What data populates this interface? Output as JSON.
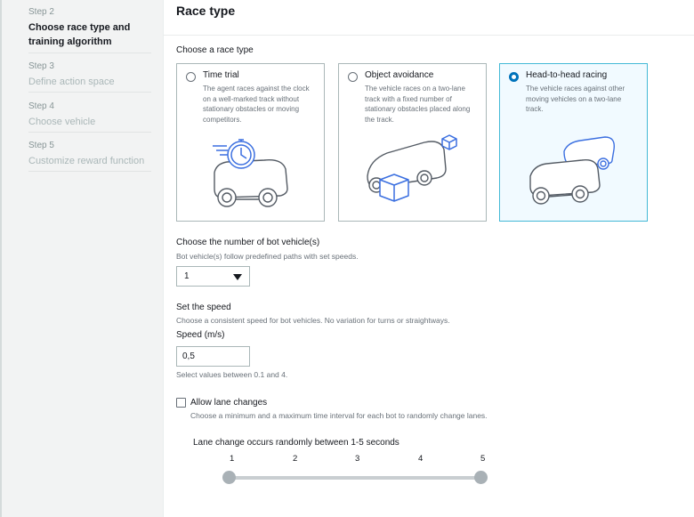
{
  "sidebar": {
    "steps": [
      {
        "number": "Step 2",
        "title": "Choose race type and training algorithm",
        "active": true
      },
      {
        "number": "Step 3",
        "title": "Define action space",
        "active": false
      },
      {
        "number": "Step 4",
        "title": "Choose vehicle",
        "active": false
      },
      {
        "number": "Step 5",
        "title": "Customize reward function",
        "active": false
      }
    ]
  },
  "header": {
    "title": "Race type"
  },
  "race_type": {
    "label": "Choose a race type",
    "selected": "Head-to-head racing",
    "options": [
      {
        "title": "Time trial",
        "description": "The agent races against the clock on a well-marked track without stationary obstacles or moving competitors.",
        "icon": "stopwatch-car-icon"
      },
      {
        "title": "Object avoidance",
        "description": "The vehicle races on a two-lane track with a fixed number of stationary obstacles placed along the track.",
        "icon": "car-obstacles-icon"
      },
      {
        "title": "Head-to-head racing",
        "description": "The vehicle races against other moving vehicles on a two-lane track.",
        "icon": "two-cars-icon"
      }
    ]
  },
  "bots": {
    "label": "Choose the number of bot vehicle(s)",
    "description": "Bot vehicle(s) follow predefined paths with set speeds.",
    "selected_value": "1"
  },
  "speed": {
    "section_label": "Set the speed",
    "section_description": "Choose a consistent speed for bot vehicles. No variation for turns or straightways.",
    "field_label": "Speed (m/s)",
    "value": "0,5",
    "hint": "Select values between 0.1 and 4."
  },
  "lane_changes": {
    "label": "Allow lane changes",
    "checked": false,
    "description": "Choose a minimum and a maximum time interval for each bot to randomly change lanes."
  },
  "slider": {
    "label": "Lane change occurs randomly between 1-5 seconds",
    "ticks": [
      "1",
      "2",
      "3",
      "4",
      "5"
    ],
    "min": 1,
    "max": 5
  },
  "colors": {
    "accent": "#0073bb",
    "selected_border": "#44b9d6",
    "illustration_dark": "#545b64",
    "illustration_blue": "#3b6fe0"
  }
}
